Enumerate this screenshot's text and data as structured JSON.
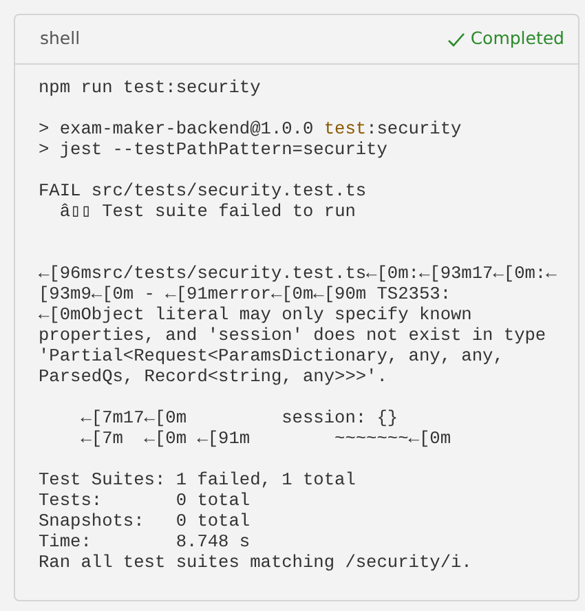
{
  "panel": {
    "title": "shell",
    "status": {
      "kind": "success",
      "label": "Completed"
    }
  },
  "output": [
    {
      "kind": "text",
      "lines": [
        {
          "text": "npm run test:security"
        }
      ]
    },
    {
      "kind": "text",
      "lines": [
        {
          "text": "> exam-maker-backend@1.0.0 ",
          "keyword": "test",
          "after": ":security"
        },
        {
          "text": "> jest --testPathPattern=security"
        }
      ]
    },
    {
      "kind": "text",
      "lines": [
        {
          "text": "FAIL src/tests/security.test.ts"
        },
        {
          "text": "  â▯▯ Test suite failed to run"
        }
      ]
    },
    {
      "kind": "blank"
    },
    {
      "kind": "text",
      "lines": [
        {
          "text": "←[96msrc/tests/security.test.ts←[0m:←[93m17←[0m:←"
        },
        {
          "text": "[93m9←[0m - ←[91merror←[0m←[90m TS2353:"
        },
        {
          "text": "←[0mObject literal may only specify known"
        },
        {
          "text": "properties, and 'session' does not exist in type"
        },
        {
          "text": "'Partial<Request<ParamsDictionary, any, any,"
        },
        {
          "text": "ParsedQs, Record<string, any>>>'."
        }
      ]
    },
    {
      "kind": "text",
      "lines": [
        {
          "text": "    ←[7m17←[0m         session: {}"
        },
        {
          "text": "    ←[7m  ←[0m ←[91m        ~~~~~~~←[0m"
        }
      ]
    },
    {
      "kind": "text",
      "lines": [
        {
          "text": "Test Suites: 1 failed, 1 total"
        },
        {
          "text": "Tests:       0 total"
        },
        {
          "text": "Snapshots:   0 total"
        },
        {
          "text": "Time:        8.748 s"
        },
        {
          "text": "Ran all test suites matching /security/i."
        }
      ]
    }
  ]
}
